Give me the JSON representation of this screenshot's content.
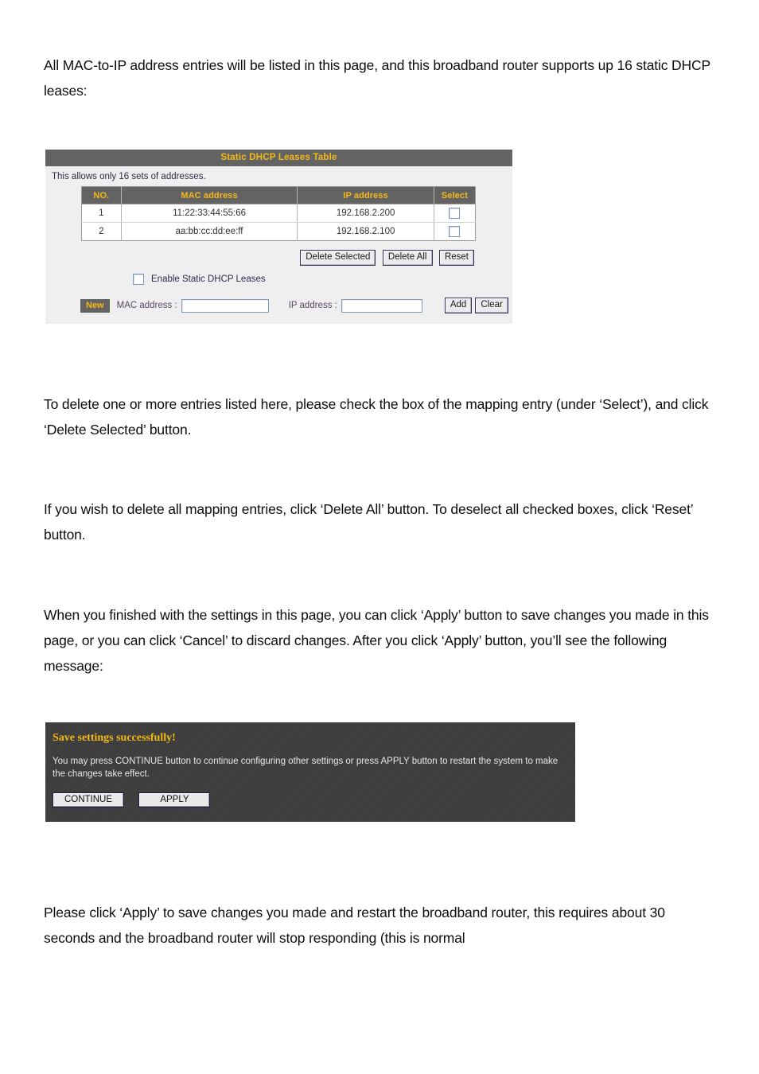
{
  "document": {
    "paragraphs": [
      "All MAC-to-IP address entries will be listed in this page, and this broadband router supports up 16 static DHCP leases:",
      "To delete one or more entries listed here, please check the box of the mapping entry (under ‘Select’), and click ‘Delete Selected’ button.",
      "If you wish to delete all mapping entries, click ‘Delete All’ button. To deselect all checked boxes, click ‘Reset’ button.",
      "When you finished with the settings in this page, you can click ‘Apply’ button to save changes you made in this page, or you can click ‘Cancel’ to discard changes. After you click ‘Apply’ button, you’ll see the following message:",
      "Please click ‘Apply’ to save changes you made and restart the broadband router, this requires about 30 seconds and the broadband router will stop responding (this is normal"
    ]
  },
  "router_panel": {
    "title": "Static DHCP Leases Table",
    "note": "This allows only 16 sets of addresses.",
    "table": {
      "headers": [
        "NO.",
        "MAC address",
        "IP address",
        "Select"
      ],
      "rows": [
        {
          "no": "1",
          "mac": "11:22:33:44:55:66",
          "ip": "192.168.2.200",
          "selected": false
        },
        {
          "no": "2",
          "mac": "aa:bb:cc:dd:ee:ff",
          "ip": "192.168.2.100",
          "selected": false
        }
      ]
    },
    "buttons": {
      "delete_selected": "Delete Selected",
      "delete_all": "Delete All",
      "reset": "Reset",
      "add": "Add",
      "clear": "Clear"
    },
    "enable_checkbox": {
      "label": "Enable Static DHCP Leases",
      "checked": false
    },
    "new_entry": {
      "badge": "New",
      "mac_label": "MAC address :",
      "mac_value": "",
      "mac_placeholder": "",
      "ip_label": "IP address :",
      "ip_value": "",
      "ip_placeholder": ""
    },
    "colors": {
      "header_bar": "#636363",
      "header_text": "#f5b914",
      "panel_bg": "#efefef",
      "button_border": "#30305e"
    }
  },
  "save_dialog": {
    "heading": "Save settings successfully!",
    "body": "You may press CONTINUE button to continue configuring other settings or press APPLY button to restart the system to make the changes take effect.",
    "continue_label": "CONTINUE",
    "apply_label": "APPLY",
    "colors": {
      "background": "#3d3d3d",
      "heading_text": "#f5b914",
      "body_text": "#e8e8e8"
    }
  }
}
